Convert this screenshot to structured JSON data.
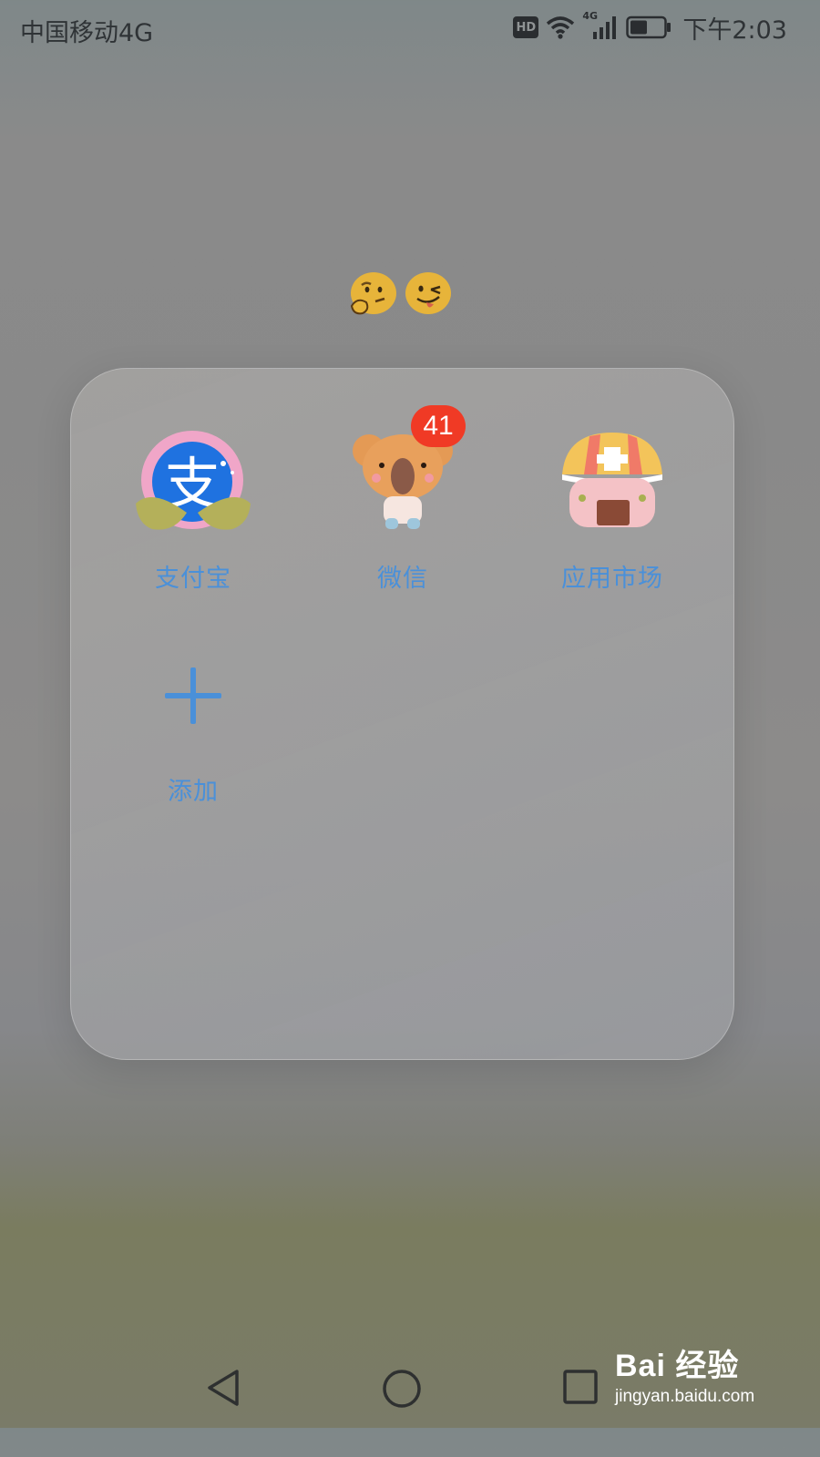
{
  "status_bar": {
    "carrier": "中国移动4G",
    "hd_label": "HD",
    "network_label": "4G",
    "time": "下午2:03"
  },
  "emojis": [
    "thinking-face",
    "winking-tongue-face"
  ],
  "folder": {
    "apps": [
      {
        "label": "支付宝",
        "icon": "alipay-icon"
      },
      {
        "label": "微信",
        "icon": "wechat-koala-icon",
        "badge": "41"
      },
      {
        "label": "应用市场",
        "icon": "app-market-icon"
      }
    ],
    "add_label": "添加"
  },
  "nav_bar": {
    "back": "back-icon",
    "home": "home-icon",
    "recents": "recents-icon"
  },
  "watermark": {
    "top": "Bai 经验",
    "bottom": "jingyan.baidu.com"
  },
  "colors": {
    "label_blue": "#4a90d9",
    "badge_red": "#f03a25"
  }
}
